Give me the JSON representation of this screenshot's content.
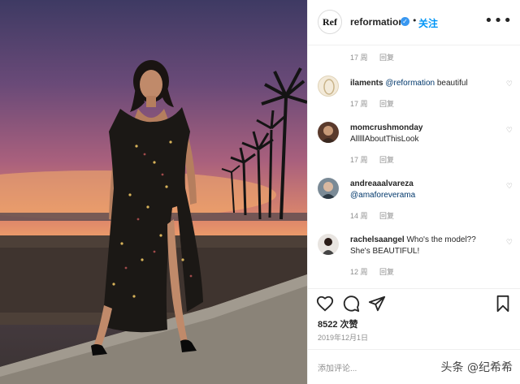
{
  "header": {
    "logo_text": "Ref",
    "username": "reformation",
    "verified_icon": "✓",
    "separator": "•",
    "follow_label": "关注",
    "more_icon": "•••"
  },
  "comments": [
    {
      "user": "",
      "text": "",
      "time": "17 周",
      "reply": "回复"
    },
    {
      "user": "ilaments",
      "mention": "@reformation",
      "text": " beautiful",
      "time": "17 周",
      "reply": "回复"
    },
    {
      "user": "momcrushmonday",
      "text": "AlllllAboutThisLook",
      "time": "17 周",
      "reply": "回复"
    },
    {
      "user": "andreaaalvareza",
      "mention": "@amaforeverama",
      "text": "",
      "time": "14 周",
      "reply": "回复"
    },
    {
      "user": "rachelsaangel",
      "text": " Who's the model?? She's BEAUTIFUL!",
      "time": "12 周",
      "reply": "回复"
    }
  ],
  "stats": {
    "likes": "8522 次赞",
    "date": "2019年12月1日"
  },
  "add_comment": {
    "placeholder": "添加评论...",
    "watermark": "头条 @纪希希"
  },
  "colors": {
    "accent": "#0095f6",
    "verified": "#3897f0",
    "muted": "#8e8e8e"
  },
  "icons": [
    "heart-icon",
    "comment-icon",
    "share-icon",
    "bookmark-icon",
    "more-icon"
  ]
}
